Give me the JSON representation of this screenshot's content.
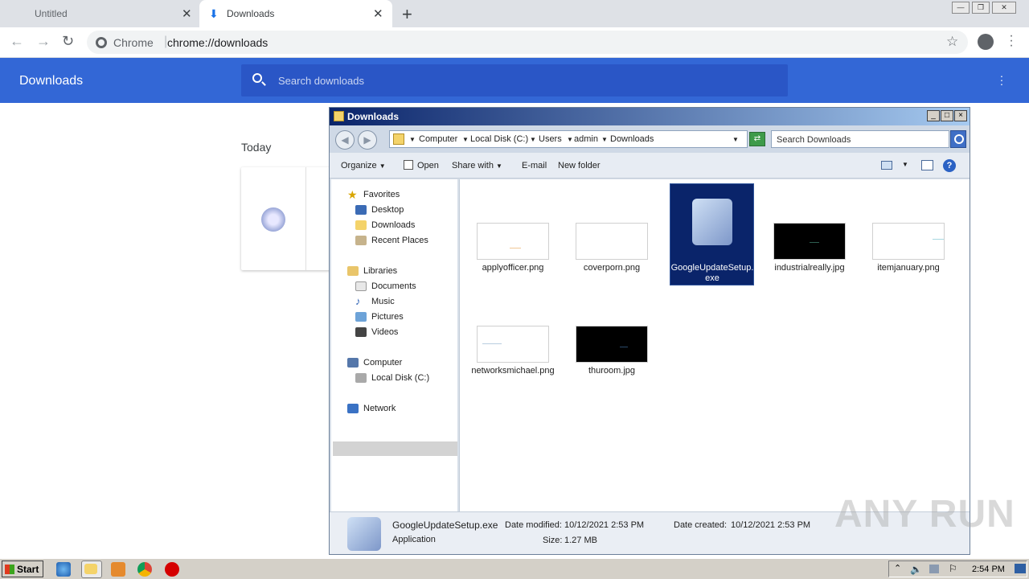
{
  "browser": {
    "tabs": [
      {
        "label": "Untitled",
        "close": "✕"
      },
      {
        "label": "Downloads",
        "close": "✕"
      }
    ],
    "new_tab": "+",
    "window_controls": {
      "minimize": "—",
      "restore": "❐",
      "close": "✕"
    },
    "omnibox": {
      "site": "Chrome",
      "separator": "|",
      "url": "chrome://downloads"
    }
  },
  "downloads_page": {
    "title": "Downloads",
    "search_placeholder": "Search downloads",
    "section_date": "Today"
  },
  "explorer": {
    "title": "Downloads",
    "breadcrumb": [
      "Computer",
      "Local Disk (C:)",
      "Users",
      "admin",
      "Downloads"
    ],
    "search_placeholder": "Search Downloads",
    "commands": {
      "organize": "Organize",
      "open": "Open",
      "share_with": "Share with",
      "email": "E-mail",
      "new_folder": "New folder"
    },
    "nav": {
      "favorites": "Favorites",
      "desktop": "Desktop",
      "downloads": "Downloads",
      "recent_places": "Recent Places",
      "libraries": "Libraries",
      "documents": "Documents",
      "music": "Music",
      "pictures": "Pictures",
      "videos": "Videos",
      "computer": "Computer",
      "local_disk": "Local Disk (C:)",
      "network": "Network"
    },
    "files": [
      {
        "name": "applyofficer.png"
      },
      {
        "name": "coverporn.png"
      },
      {
        "name": "GoogleUpdateSetup.exe"
      },
      {
        "name": "industrialreally.jpg"
      },
      {
        "name": "itemjanuary.png"
      },
      {
        "name": "networksmichael.png"
      },
      {
        "name": "thuroom.jpg"
      }
    ],
    "details": {
      "filename": "GoogleUpdateSetup.exe",
      "type": "Application",
      "date_modified_label": "Date modified:",
      "date_modified": "10/12/2021 2:53 PM",
      "size_label": "Size:",
      "size": "1.27 MB",
      "date_created_label": "Date created:",
      "date_created": "10/12/2021 2:53 PM"
    }
  },
  "watermark": "ANY RUN",
  "taskbar": {
    "start": "Start",
    "clock": "2:54 PM"
  },
  "colors": {
    "chrome_blue": "#3367d6",
    "selection": "#0a246a"
  }
}
